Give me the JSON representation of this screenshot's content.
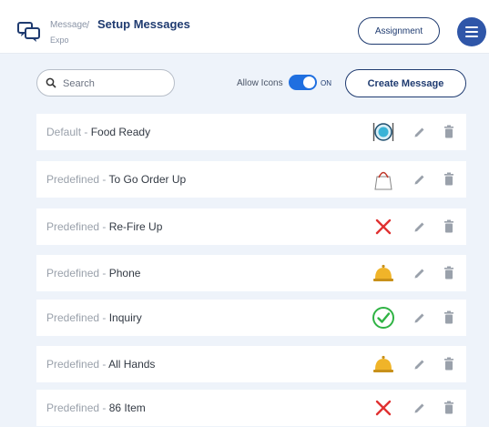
{
  "header": {
    "breadcrumb_parent": "Message",
    "breadcrumb_separator": "/",
    "title": "Setup Messages",
    "subtitle": "Expo",
    "assignment_label": "Assignment",
    "menu_icon": "hamburger-menu-icon"
  },
  "toolbar": {
    "search_placeholder": "Search",
    "search_value": "",
    "allow_icons_label": "Allow Icons",
    "allow_icons_on": true,
    "allow_icons_state": "ON",
    "create_label": "Create Message"
  },
  "messages": [
    {
      "type": "Default",
      "separator": " - ",
      "name": "Food Ready",
      "icon": "food-plate-icon"
    },
    {
      "type": "Predefined",
      "separator": " - ",
      "name": "To Go Order Up",
      "icon": "to-go-bag-icon"
    },
    {
      "type": "Predefined",
      "separator": " - ",
      "name": "Re-Fire Up",
      "icon": "red-x-icon"
    },
    {
      "type": "Predefined",
      "separator": " - ",
      "name": "Phone",
      "icon": "service-bell-icon"
    },
    {
      "type": "Predefined",
      "separator": " - ",
      "name": "Inquiry",
      "icon": "green-check-icon"
    },
    {
      "type": "Predefined",
      "separator": " - ",
      "name": "All Hands",
      "icon": "service-bell-icon"
    },
    {
      "type": "Predefined",
      "separator": " - ",
      "name": "86 Item",
      "icon": "red-x-icon"
    }
  ],
  "colors": {
    "primary": "#1f3b70",
    "accent": "#2f56a8",
    "toggle": "#1f6fe0",
    "background": "#eef3fa",
    "red_x": "#e03131",
    "green_check": "#2fb344",
    "bell_gold": "#f0b429"
  }
}
